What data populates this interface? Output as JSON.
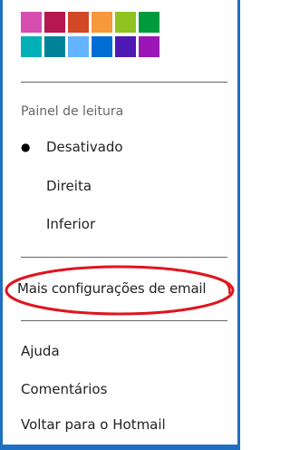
{
  "theme_swatches": [
    {
      "name": "pink",
      "color": "#d64db0"
    },
    {
      "name": "crimson",
      "color": "#b5174e"
    },
    {
      "name": "red-orange",
      "color": "#d24726"
    },
    {
      "name": "orange",
      "color": "#f7983a"
    },
    {
      "name": "lime",
      "color": "#8fc31f"
    },
    {
      "name": "green",
      "color": "#009a3e"
    },
    {
      "name": "teal",
      "color": "#00b0b6"
    },
    {
      "name": "dark-teal",
      "color": "#008299"
    },
    {
      "name": "sky-blue",
      "color": "#63b3ff"
    },
    {
      "name": "blue",
      "color": "#006dd5"
    },
    {
      "name": "indigo",
      "color": "#4e19b2"
    },
    {
      "name": "purple",
      "color": "#9b16b6"
    }
  ],
  "reading_pane": {
    "title": "Painel de leitura",
    "options": [
      {
        "label": "Desativado",
        "selected": true
      },
      {
        "label": "Direita",
        "selected": false
      },
      {
        "label": "Inferior",
        "selected": false
      }
    ],
    "selected_marker": "●"
  },
  "more_settings": {
    "label": "Mais configurações de email",
    "highlight_color": "#e0141e"
  },
  "footer_links": [
    {
      "label": "Ajuda"
    },
    {
      "label": "Comentários"
    },
    {
      "label": "Voltar para o Hotmail"
    }
  ],
  "frame_color": "#1f6fc2"
}
